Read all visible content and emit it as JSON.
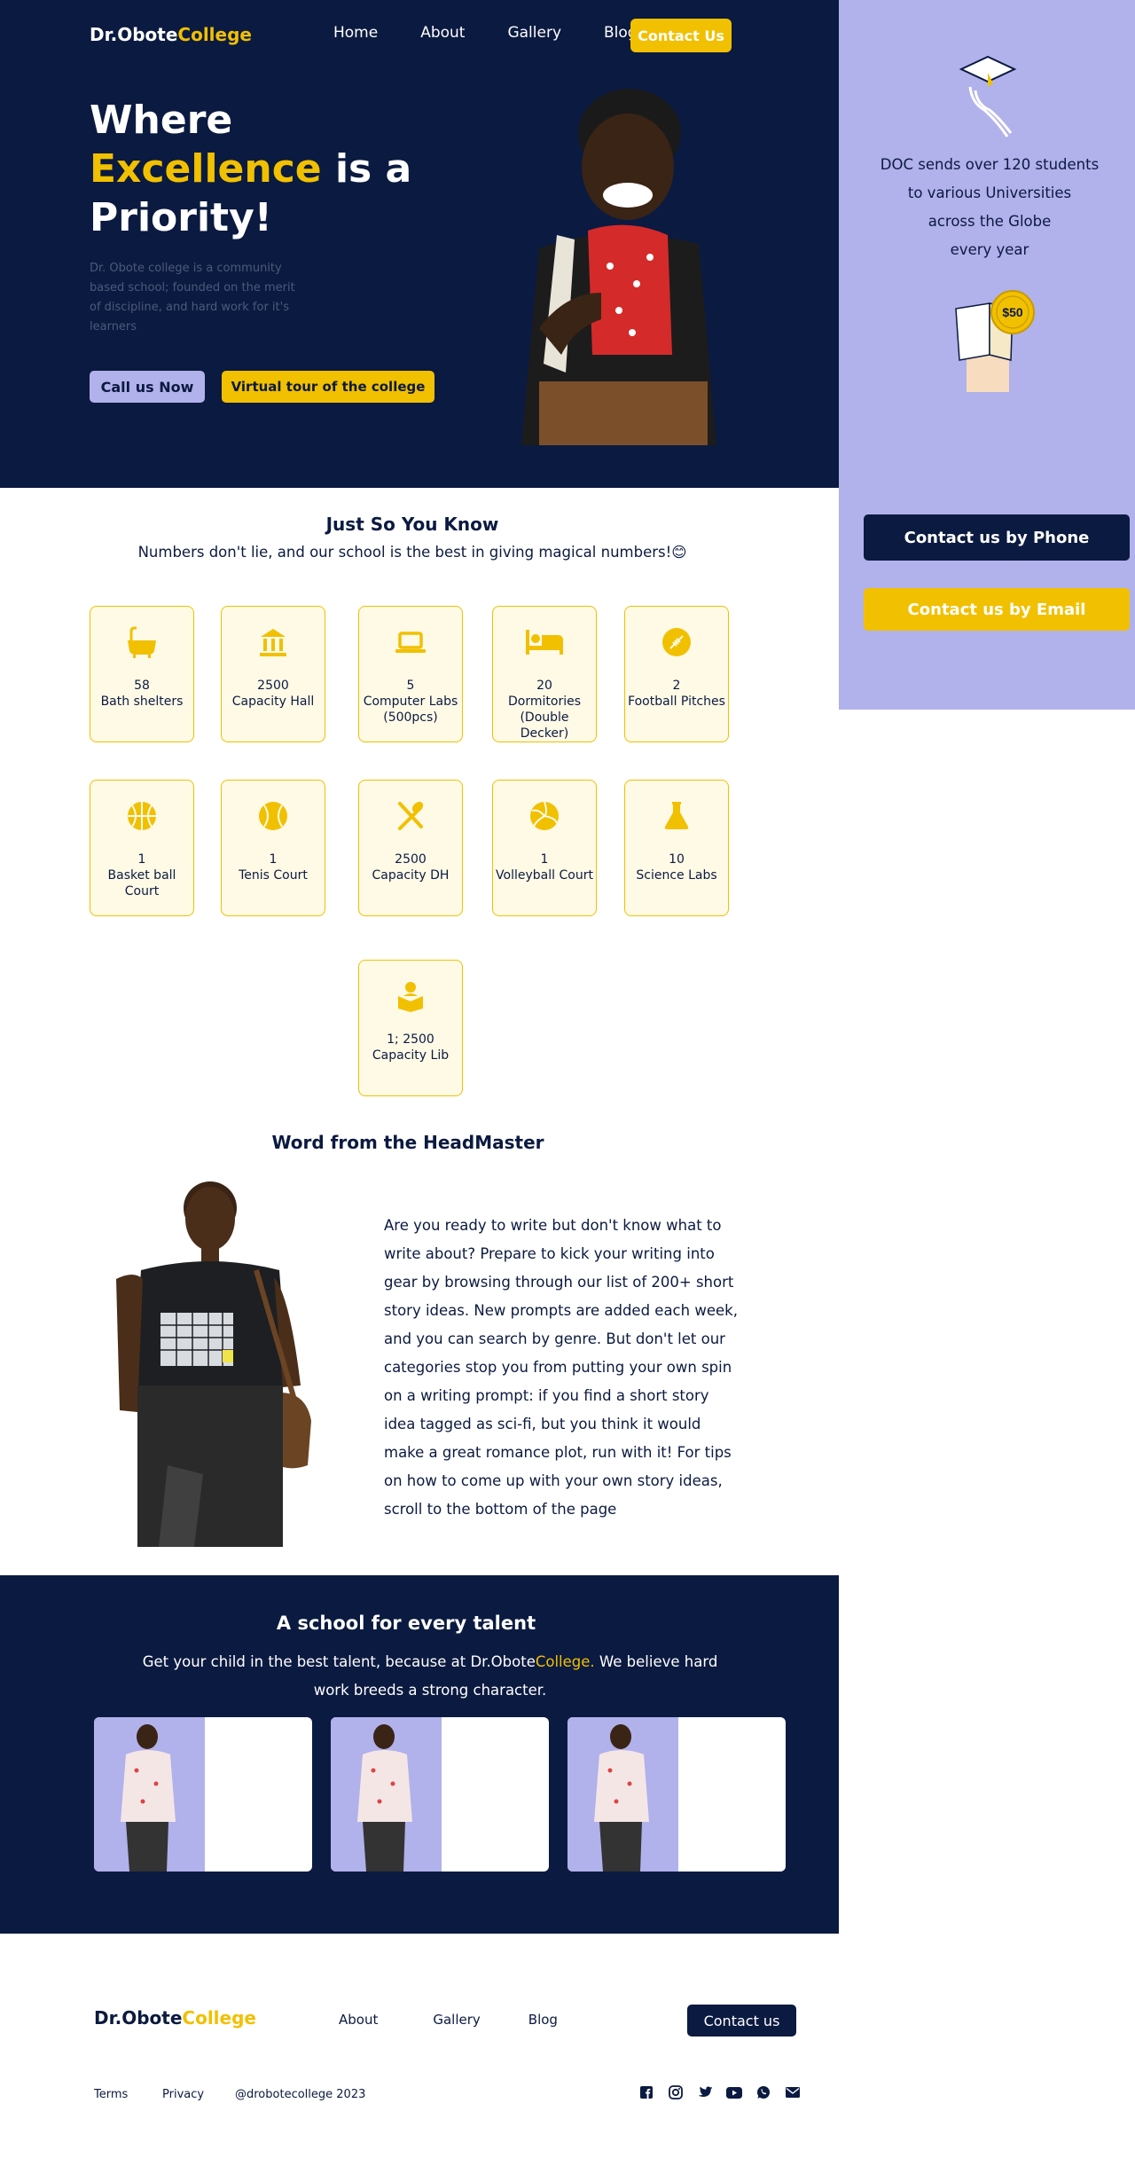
{
  "brand": {
    "name_part1": "Dr.Obote",
    "name_part2": "College"
  },
  "nav": {
    "items": [
      "Home",
      "About",
      "Gallery",
      "Blog"
    ],
    "contact": "Contact Us"
  },
  "hero": {
    "title_line1": "Where",
    "title_highlight": "Excellence",
    "title_rest": " is a",
    "title_line3": "Priority!",
    "description": "Dr. Obote college is a community based school; founded on the merit of discipline, and hard work for it's learners",
    "btn_call": "Call us Now",
    "btn_tour": "Virtual tour of the college"
  },
  "sidebar": {
    "stat_line1": "DOC sends over 120 students",
    "stat_line2": "to various Universities",
    "stat_line3": "across the Globe",
    "stat_line4": "every year",
    "coin_text": "$50",
    "btn_phone": "Contact us by Phone",
    "btn_email": "Contact us by Email"
  },
  "facts": {
    "title": "Just So You Know",
    "subtitle": "Numbers don't lie, and our school is the best in giving magical numbers!😊",
    "items": [
      {
        "value": "58",
        "label": "Bath shelters",
        "icon": "bathtub-icon"
      },
      {
        "value": "2500",
        "label": "Capacity Hall",
        "icon": "hall-icon"
      },
      {
        "value": "5",
        "label": "Computer Labs (500pcs)",
        "icon": "laptop-icon"
      },
      {
        "value": "20",
        "label": "Dormitories (Double Decker)",
        "icon": "bed-icon"
      },
      {
        "value": "2",
        "label": "Football Pitches",
        "icon": "football-icon"
      },
      {
        "value": "1",
        "label": "Basket ball Court",
        "icon": "basketball-icon"
      },
      {
        "value": "1",
        "label": "Tenis Court",
        "icon": "tennis-icon"
      },
      {
        "value": "2500",
        "label": "Capacity DH",
        "icon": "dining-icon"
      },
      {
        "value": "1",
        "label": "Volleyball Court",
        "icon": "volleyball-icon"
      },
      {
        "value": "10",
        "label": "Science Labs",
        "icon": "flask-icon"
      },
      {
        "value": "1; 2500",
        "label": "Capacity Lib",
        "icon": "reader-icon"
      }
    ]
  },
  "headmaster": {
    "title": "Word from the HeadMaster",
    "text": "Are you ready to write but don't know what to write about? Prepare to kick your writing into gear by browsing through our list of 200+ short story ideas. New prompts are added each week, and you can search by genre. But don't let our categories stop you from putting your own spin on a writing prompt: if you find a short story idea tagged as sci-fi, but you think it would make a great romance plot, run with it! For tips on how to come up with your own story ideas, scroll to the bottom of the page"
  },
  "talent": {
    "title": "A school for every talent",
    "desc_part1": "Get your child in the best talent, because at Dr.Obote",
    "desc_highlight": "College.",
    "desc_part2": " We believe hard work breeds a strong character."
  },
  "footer": {
    "links": [
      "About",
      "Gallery",
      "Blog"
    ],
    "contact": "Contact us",
    "terms": "Terms",
    "privacy": "Privacy",
    "copyright": "@drobotecollege 2023",
    "socials": [
      "facebook-icon",
      "instagram-icon",
      "twitter-icon",
      "youtube-icon",
      "whatsapp-icon",
      "mail-icon"
    ]
  },
  "colors": {
    "navy": "#0b1a40",
    "gold": "#f1c000",
    "lavender": "#b1b1eb"
  }
}
